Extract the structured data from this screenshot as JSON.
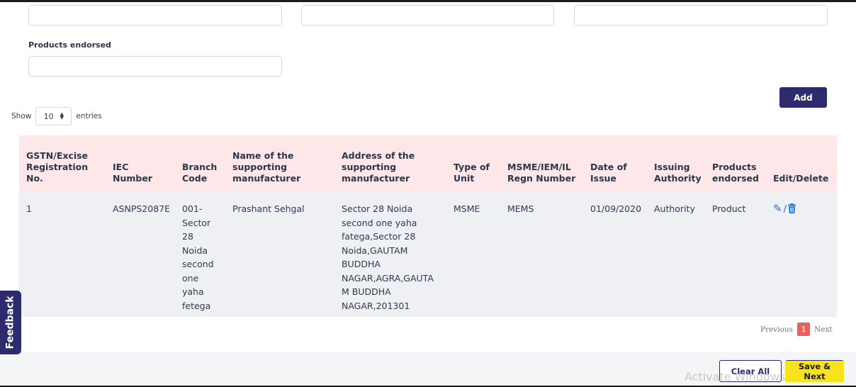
{
  "form": {
    "products_endorsed_label": "Products endorsed",
    "add_button": "Add"
  },
  "length": {
    "show_label": "Show",
    "value": "10",
    "entries_label": "entries"
  },
  "table": {
    "headers": [
      "GSTN/Excise Registration No.",
      "IEC Number",
      "Branch Code",
      "Name of the supporting manufacturer",
      "Address of the supporting manufacturer",
      "Type of Unit",
      "MSME/IEM/IL Regn Number",
      "Date of Issue",
      "Issuing Authority",
      "Products endorsed",
      "Edit/Delete"
    ],
    "rows": [
      {
        "reg_no": "1",
        "iec": "ASNPS2087E",
        "branch": "001-Sector 28 Noida second one yaha fetega",
        "name": "Prashant Sehgal",
        "address": "Sector 28 Noida second one yaha fatega,Sector 28 Noida,GAUTAM BUDDHA NAGAR,AGRA,GAUTAM BUDDHA NAGAR,201301",
        "unit_type": "MSME",
        "regn": "MEMS",
        "date": "01/09/2020",
        "authority": "Authority",
        "products": "Product",
        "action_separator": "/"
      }
    ]
  },
  "pagination": {
    "previous": "Previous",
    "current": "1",
    "next": "Next"
  },
  "feedback": "Feedback",
  "footer": {
    "clear_all": "Clear All",
    "save_next": "Save & Next"
  },
  "watermark": "Activate Windows",
  "colors": {
    "primary": "#2c2b6e",
    "header_bg": "#fde7e8",
    "row_bg": "#eef0f4",
    "page_active": "#e8605f",
    "save_highlight": "#f7e21b"
  },
  "icons": {
    "edit": "pencil-icon",
    "delete": "trash-icon",
    "sort": "sort-icon"
  }
}
